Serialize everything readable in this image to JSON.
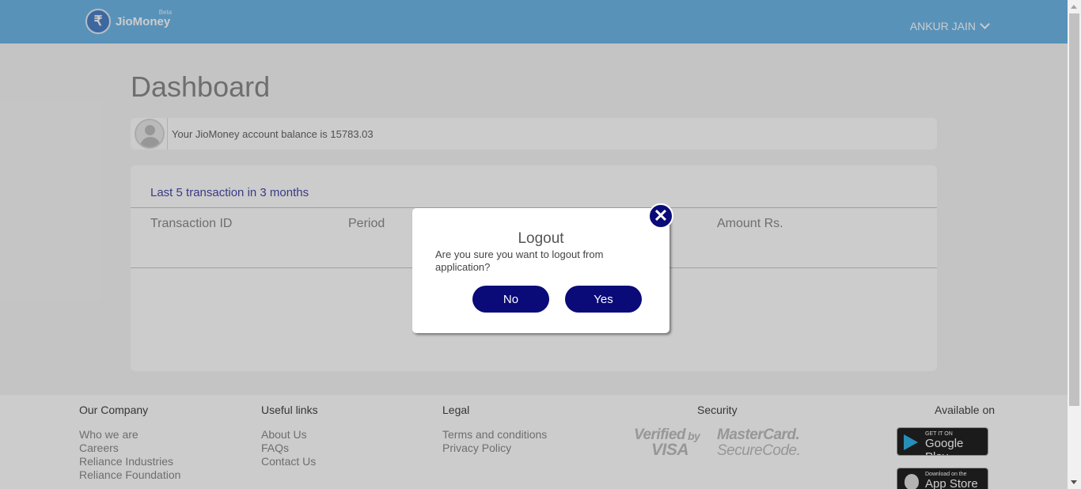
{
  "header": {
    "logo_symbol": "₹",
    "logo_text": "JioMoney",
    "logo_tag": "Beta",
    "user_name": "ANKUR JAIN"
  },
  "dashboard": {
    "title": "Dashboard",
    "balance_text": "Your JioMoney account balance is 15783.03",
    "transactions": {
      "title": "Last 5 transaction in 3 months",
      "columns": [
        "Transaction ID",
        "Period",
        "Amount Rs."
      ]
    }
  },
  "footer": {
    "our_company": {
      "heading": "Our Company",
      "links": [
        "Who we are",
        "Careers",
        "Reliance Industries",
        "Reliance Foundation"
      ]
    },
    "useful_links": {
      "heading": "Useful links",
      "links": [
        "About Us",
        "FAQs",
        "Contact Us"
      ]
    },
    "legal": {
      "heading": "Legal",
      "links": [
        "Terms and conditions",
        "Privacy Policy"
      ]
    },
    "security": {
      "heading": "Security",
      "verified_by": "Verified",
      "by": "by",
      "visa": "VISA",
      "mastercard": "MasterCard.",
      "securecode": "SecureCode."
    },
    "available_on": {
      "heading": "Available on",
      "google_small": "GET IT ON",
      "google_big": "Google Play",
      "apple_small": "Download on the",
      "apple_big": "App Store"
    }
  },
  "modal": {
    "title": "Logout",
    "message": "Are you sure you want to logout from application?",
    "no_label": "No",
    "yes_label": "Yes",
    "close_symbol": "✕"
  },
  "colors": {
    "header_bg": "#6fb7e8",
    "primary_button": "#0a0a78",
    "overlay": "rgba(0,0,0,0.2)"
  }
}
